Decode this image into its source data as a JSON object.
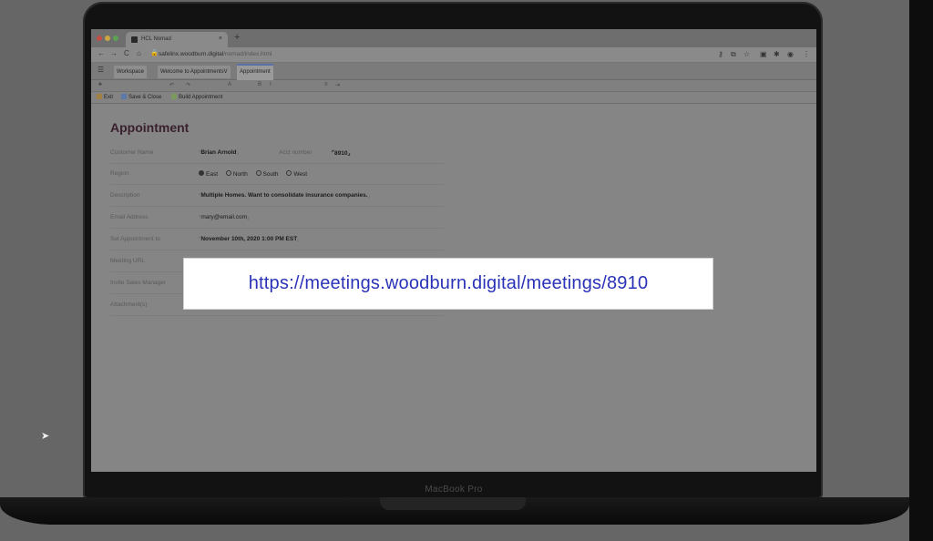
{
  "device": {
    "brand_label": "MacBook Pro"
  },
  "browser": {
    "tab_title": "HCL Nomad",
    "tab_close": "×",
    "new_tab": "+",
    "url_host": "safelinx.woodburn.digital",
    "url_path": "/nomad/index.html",
    "nav": {
      "back": "←",
      "forward": "→",
      "reload": "C",
      "home": "⌂"
    }
  },
  "app_tabs": [
    {
      "label": "Workspace"
    },
    {
      "label": "Welcome to AppointmentsV"
    },
    {
      "label": "Appointment"
    }
  ],
  "action_bar": {
    "exit_label": "Exit",
    "save_close_label": "Save & Close",
    "build_label": "Build Appointment"
  },
  "form": {
    "title": "Appointment",
    "customer_name_label": "Customer Name",
    "customer_name_value": "Brian Arnold",
    "acct_number_label": "Acct number",
    "acct_number_value": "8910",
    "region_label": "Region",
    "region_options": [
      "East",
      "North",
      "South",
      "West"
    ],
    "region_selected": "East",
    "description_label": "Description",
    "description_value": "Multiple Homes. Want to consolidate insurance companies.",
    "email_label": "Email Address",
    "email_value": "mary@email.com",
    "appointment_label": "Set Appointment to",
    "appointment_value": "November 10th, 2020 1:00 PM EST",
    "meeting_url_label": "Meeting URL",
    "invite_label": "Invite Sales Manager",
    "attachments_label": "Attachment(s)"
  },
  "overlay": {
    "meeting_url": "https://meetings.woodburn.digital/meetings/8910"
  },
  "colors": {
    "overlay_text": "#2a33b8",
    "page_background": "#666666"
  }
}
